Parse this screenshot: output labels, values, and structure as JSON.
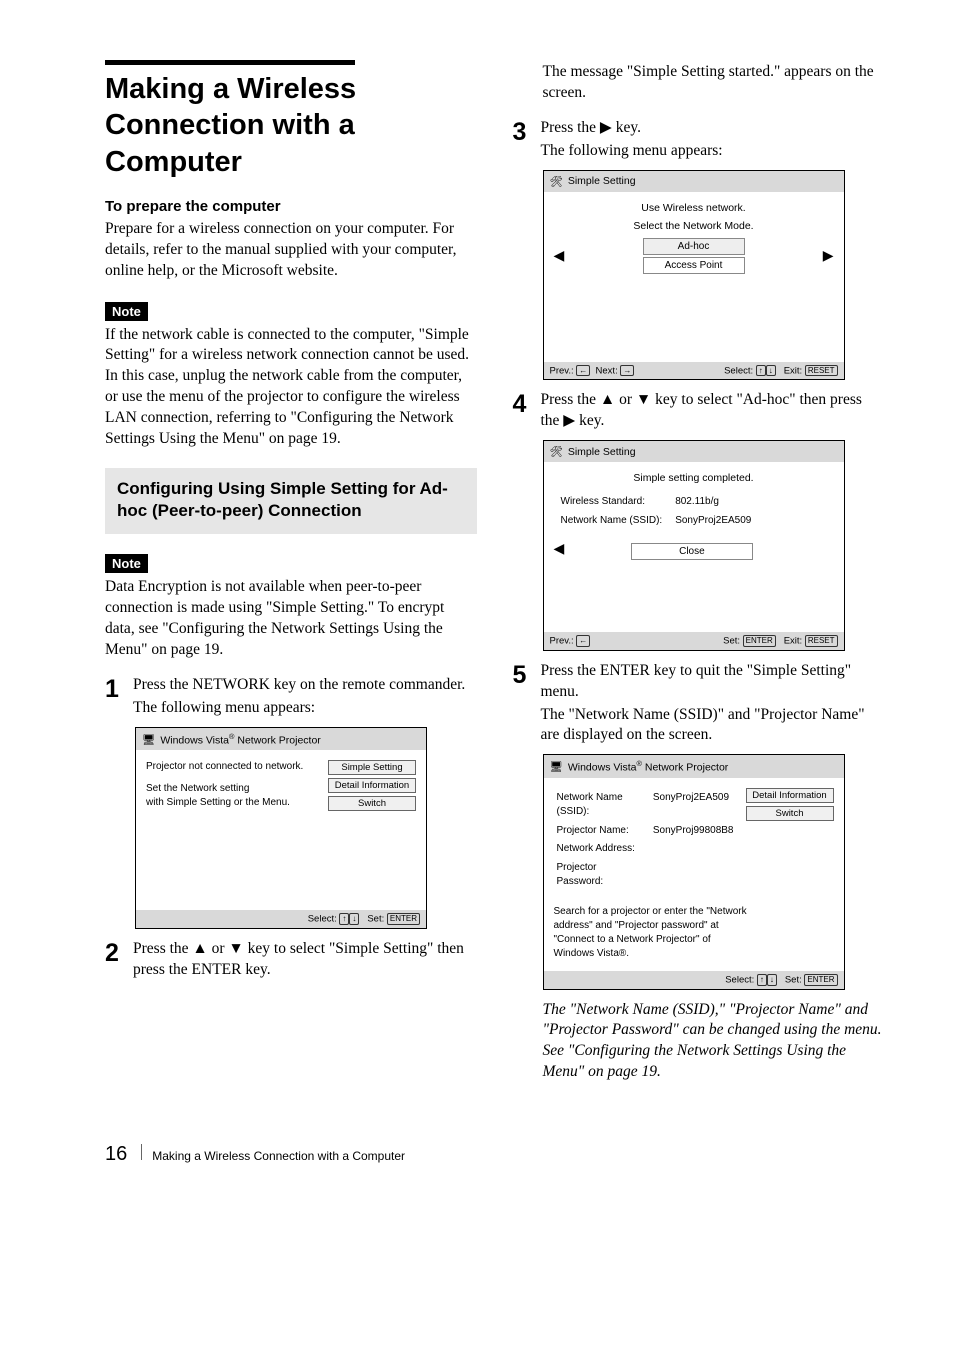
{
  "page": {
    "number": "16",
    "footer_text": "Making a Wireless Connection with a Computer"
  },
  "left": {
    "title": "Making a Wireless Connection with a Computer",
    "sub1": "To prepare the computer",
    "para1": "Prepare for a wireless connection on your computer. For details, refer to the manual supplied with your computer, online help, or the Microsoft website.",
    "note1_label": "Note",
    "note1_text": "If the network cable is connected to the computer, \"Simple Setting\" for a wireless network connection cannot be used. In this case, unplug the network cable from the computer, or use the menu of the projector to configure the wireless LAN connection, referring to \"Configuring the Network Settings Using the Menu\" on page 19.",
    "section_title": "Configuring Using Simple Setting for Ad-hoc (Peer-to-peer) Connection",
    "note2_label": "Note",
    "note2_text": "Data Encryption is not available when peer-to-peer connection is made using \"Simple Setting.\" To encrypt data, see \"Configuring the Network Settings Using the Menu\" on page 19.",
    "step1_num": "1",
    "step1_line1": "Press the NETWORK key on the remote commander.",
    "step1_line2": "The following menu appears:",
    "ss1": {
      "title_pre": "Windows Vista",
      "title_post": " Network Projector",
      "line1": "Projector not connected to network.",
      "line2": "Set the Network setting",
      "line3": "with Simple Setting or the Menu.",
      "btn1": "Simple Setting",
      "btn2": "Detail Information",
      "btn3": "Switch",
      "foot_left": "",
      "foot_select": "Select: ",
      "foot_set": "Set: ",
      "foot_set_key": "ENTER"
    },
    "step2_num": "2",
    "step2_text": "Press the ▲ or ▼ key to select \"Simple Setting\" then press the ENTER key."
  },
  "right": {
    "intro": "The message \"Simple Setting started.\" appears on the screen.",
    "step3_num": "3",
    "step3_line1": "Press the ▶ key.",
    "step3_line2": "The following menu appears:",
    "ss2": {
      "title": "Simple Setting",
      "line1": "Use Wireless network.",
      "line2": "Select the Network Mode.",
      "opt1": "Ad-hoc",
      "opt2": "Access Point",
      "foot_prev": "Prev.: ",
      "foot_next": "Next: ",
      "foot_select": "Select: ",
      "foot_exit": "Exit: ",
      "foot_exit_key": "RESET"
    },
    "step4_num": "4",
    "step4_text": "Press the ▲ or ▼ key to select \"Ad-hoc\" then press the ▶ key.",
    "ss3": {
      "title": "Simple Setting",
      "line1": "Simple setting completed.",
      "row1_k": "Wireless Standard:",
      "row1_v": "802.11b/g",
      "row2_k": "Network Name (SSID):",
      "row2_v": "SonyProj2EA509",
      "close": "Close",
      "foot_prev": "Prev.: ",
      "foot_set": "Set: ",
      "foot_set_key": "ENTER",
      "foot_exit": "Exit: ",
      "foot_exit_key": "RESET"
    },
    "step5_num": "5",
    "step5_line1": "Press the ENTER key to quit the \"Simple Setting\" menu.",
    "step5_line2": "The \"Network Name (SSID)\" and \"Projector Name\" are displayed on the screen.",
    "ss4": {
      "title_pre": "Windows Vista",
      "title_post": " Network Projector",
      "row1_k": "Network Name (SSID):",
      "row1_v": "SonyProj2EA509",
      "row2_k": "Projector Name:",
      "row2_v": "SonyProj99808B8",
      "row3_k": "Network Address:",
      "row4_k": "Projector Password:",
      "btn1": "Detail Information",
      "btn2": "Switch",
      "copy_l1": "Search for a projector or enter the \"Network",
      "copy_l2": "address\" and \"Projector password\" at",
      "copy_l3": "\"Connect to a Network Projector\" of",
      "copy_l4": "Windows Vista®.",
      "foot_select": "Select: ",
      "foot_set": "Set: ",
      "foot_set_key": "ENTER"
    },
    "italic": "The \"Network Name (SSID),\" \"Projector Name\" and \"Projector Password\" can be changed using the menu. See \"Configuring the Network Settings Using the Menu\" on page 19."
  }
}
